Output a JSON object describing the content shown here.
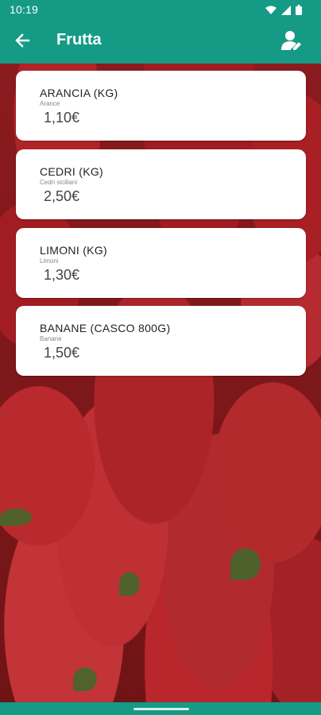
{
  "status_bar": {
    "time": "10:19"
  },
  "app_bar": {
    "title": "Frutta",
    "accent_color": "#159a86"
  },
  "products": [
    {
      "name": "ARANCIA (KG)",
      "subtitle": "Arance",
      "price": "1,10€"
    },
    {
      "name": "CEDRI (KG)",
      "subtitle": "Cedri siciliani",
      "price": "2,50€"
    },
    {
      "name": "LIMONI (KG)",
      "subtitle": "Limoni",
      "price": "1,30€"
    },
    {
      "name": "BANANE (CASCO 800G)",
      "subtitle": "Banane",
      "price": "1,50€"
    }
  ],
  "icons": {
    "back": "arrow-left-icon",
    "profile": "user-edit-icon",
    "wifi": "wifi-icon",
    "signal": "signal-icon",
    "battery": "battery-icon"
  }
}
